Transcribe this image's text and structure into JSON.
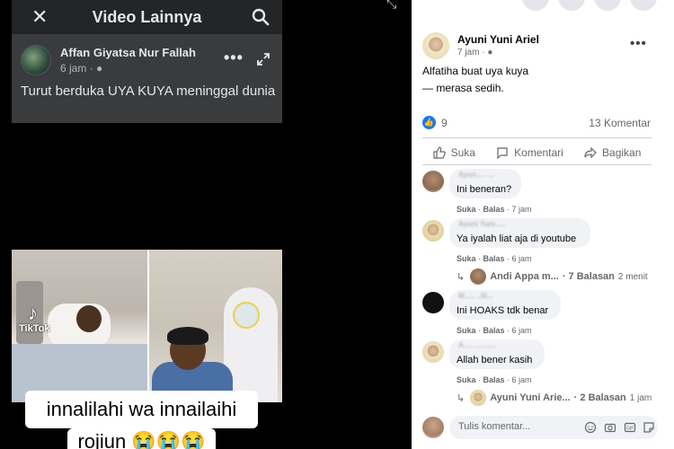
{
  "video_viewer": {
    "header_title": "Video Lainnya",
    "post_author": "Affan Giyatsa Nur Fallah",
    "post_time": "6 jam · ",
    "post_text": "Turut berduka UYA KUYA meninggal dunia",
    "watermark": "TikTok",
    "caption_line1": "innalilahi wa innailaihi",
    "caption_line2": "rojiun 😭😭😭"
  },
  "post": {
    "author": "Ayuni Yuni Ariel",
    "time": "7 jam · ",
    "text_line1": "Alfatiha buat uya kuya",
    "text_line2": "— merasa sedih.",
    "like_count": "9",
    "comment_count": "13 Komentar",
    "actions": {
      "like": "Suka",
      "comment": "Komentari",
      "share": "Bagikan"
    }
  },
  "comments": [
    {
      "text": "Ini beneran?",
      "meta_like": "Suka",
      "meta_reply": "Balas",
      "time": "7 jam"
    },
    {
      "text": "Ya iyalah liat aja di youtube",
      "meta_like": "Suka",
      "meta_reply": "Balas",
      "time": "6 jam",
      "replies": {
        "name": "Andi Appa m...",
        "count": "· 7 Balasan",
        "time": "2 menit"
      }
    },
    {
      "text": "Ini HOAKS tdk benar",
      "meta_like": "Suka",
      "meta_reply": "Balas",
      "time": "6 jam"
    },
    {
      "text": "Allah bener kasih",
      "meta_like": "Suka",
      "meta_reply": "Balas",
      "time": "6 jam",
      "replies": {
        "name": "Ayuni Yuni Arie...",
        "count": "· 2 Balasan",
        "time": "1 jam"
      }
    }
  ],
  "compose": {
    "placeholder": "Tulis komentar..."
  },
  "colors": {
    "facebook_blue": "#1877f2",
    "dark_surface": "#242526",
    "bubble_bg": "#f0f2f5",
    "secondary_text": "#65676b"
  }
}
